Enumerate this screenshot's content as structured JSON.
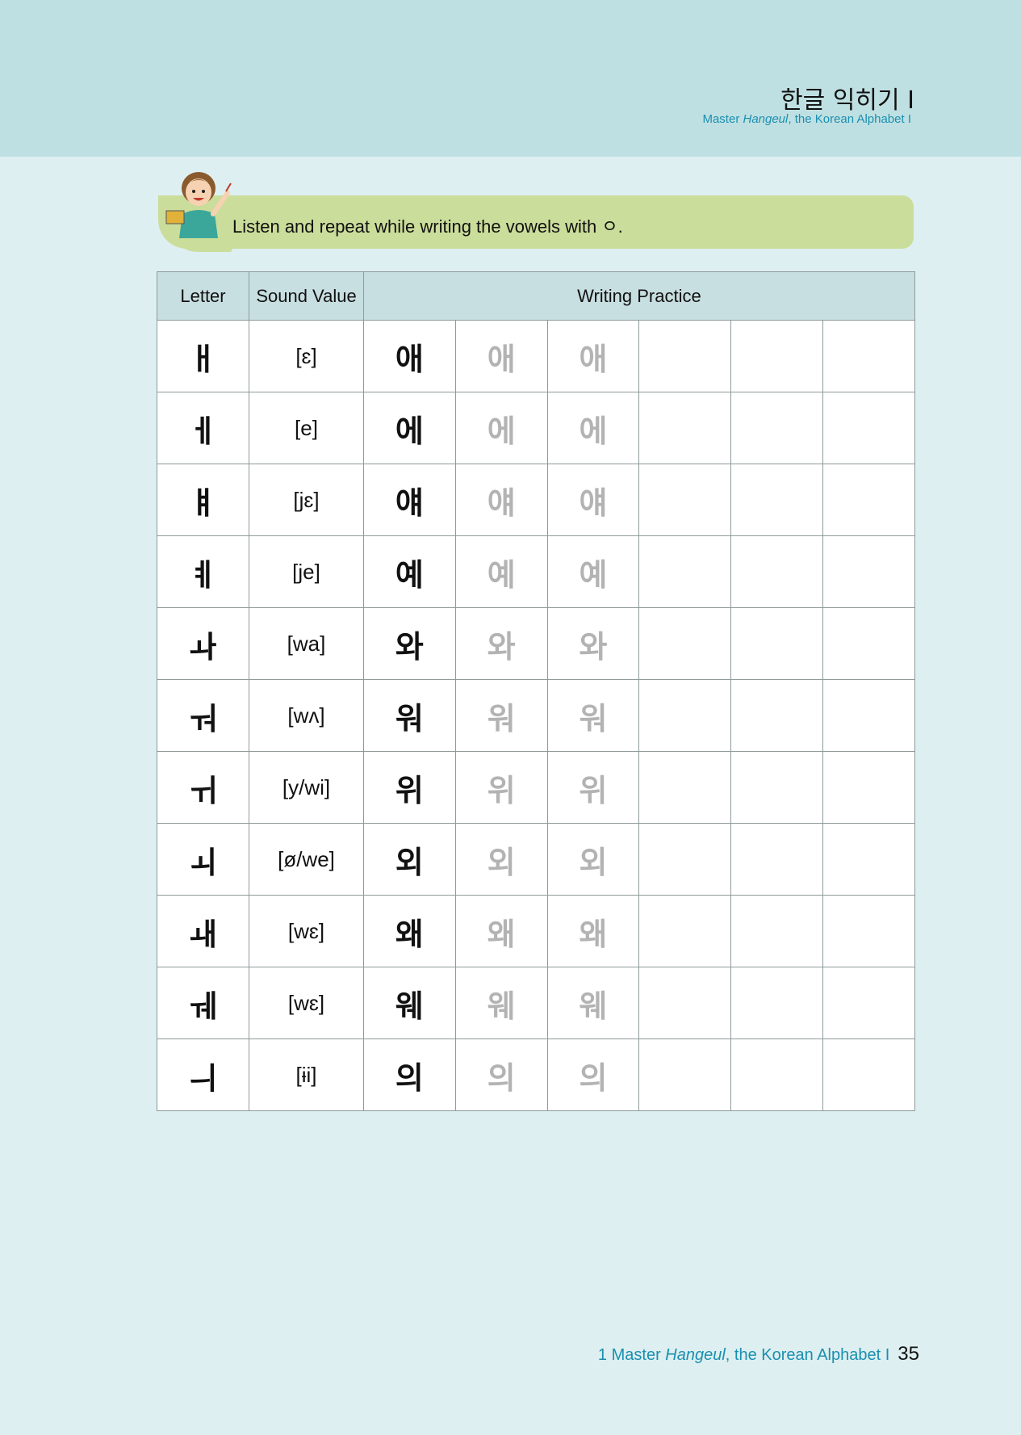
{
  "header": {
    "title_ko": "한글 익히기 I",
    "subtitle_pre": "Master ",
    "subtitle_italic": "Hangeul",
    "subtitle_post": ", the Korean Alphabet I"
  },
  "instruction": "Listen and repeat while writing the vowels with ㅇ.",
  "table": {
    "headers": [
      "Letter",
      "Sound Value",
      "Writing Practice"
    ],
    "rows": [
      {
        "letter": "ㅐ",
        "sound": "[ɛ]",
        "syllable": "애"
      },
      {
        "letter": "ㅔ",
        "sound": "[e]",
        "syllable": "에"
      },
      {
        "letter": "ㅒ",
        "sound": "[jɛ]",
        "syllable": "얘"
      },
      {
        "letter": "ㅖ",
        "sound": "[je]",
        "syllable": "예"
      },
      {
        "letter": "ㅘ",
        "sound": "[wa]",
        "syllable": "와"
      },
      {
        "letter": "ㅝ",
        "sound": "[wʌ]",
        "syllable": "워"
      },
      {
        "letter": "ㅟ",
        "sound": "[y/wi]",
        "syllable": "위"
      },
      {
        "letter": "ㅚ",
        "sound": "[ø/we]",
        "syllable": "외"
      },
      {
        "letter": "ㅙ",
        "sound": "[wɛ]",
        "syllable": "왜"
      },
      {
        "letter": "ㅞ",
        "sound": "[wɛ]",
        "syllable": "웨"
      },
      {
        "letter": "ㅢ",
        "sound": "[ɨi]",
        "syllable": "의"
      }
    ]
  },
  "footer": {
    "pre": "1 Master ",
    "italic": "Hangeul",
    "post": ", the Korean Alphabet I",
    "page_number": "35"
  }
}
